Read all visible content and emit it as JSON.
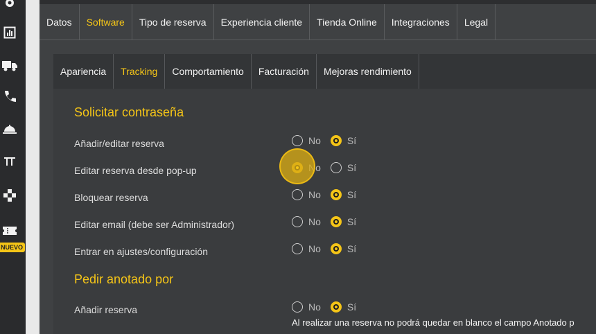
{
  "colors": {
    "accent": "#f5c517",
    "background": "#3f4143",
    "rail": "#2a2b2d"
  },
  "sidebar": {
    "icons": [
      "gear-icon",
      "chart-icon",
      "truck-icon",
      "phone-icon",
      "cloche-icon",
      "pi-icon",
      "gamepad-icon",
      "ticket-icon"
    ],
    "new_badge": "NUEVO"
  },
  "main_tabs": [
    "Datos",
    "Software",
    "Tipo de reserva",
    "Experiencia cliente",
    "Tienda Online",
    "Integraciones",
    "Legal"
  ],
  "main_tabs_active": "Software",
  "sub_tabs": [
    "Apariencia",
    "Tracking",
    "Comportamiento",
    "Facturación",
    "Mejoras rendimiento"
  ],
  "sub_tabs_active": "Tracking",
  "password_section": {
    "title": "Solicitar contraseña",
    "rows": [
      {
        "label": "Añadir/editar reserva",
        "no": "No",
        "yes": "Sí",
        "selected": "yes"
      },
      {
        "label": "Editar reserva desde pop-up",
        "no": "No",
        "yes": "Sí",
        "selected": "no"
      },
      {
        "label": "Bloquear reserva",
        "no": "No",
        "yes": "Sí",
        "selected": "yes"
      },
      {
        "label": "Editar email (debe ser Administrador)",
        "no": "No",
        "yes": "Sí",
        "selected": "yes"
      },
      {
        "label": "Entrar en ajustes/configuración",
        "no": "No",
        "yes": "Sí",
        "selected": "yes"
      }
    ]
  },
  "annotated_section": {
    "title": "Pedir anotado por",
    "rows": [
      {
        "label": "Añadir reserva",
        "no": "No",
        "yes": "Sí",
        "selected": "yes"
      }
    ],
    "note": "Al realizar una reserva no podrá quedar en blanco el campo Anotado p"
  }
}
